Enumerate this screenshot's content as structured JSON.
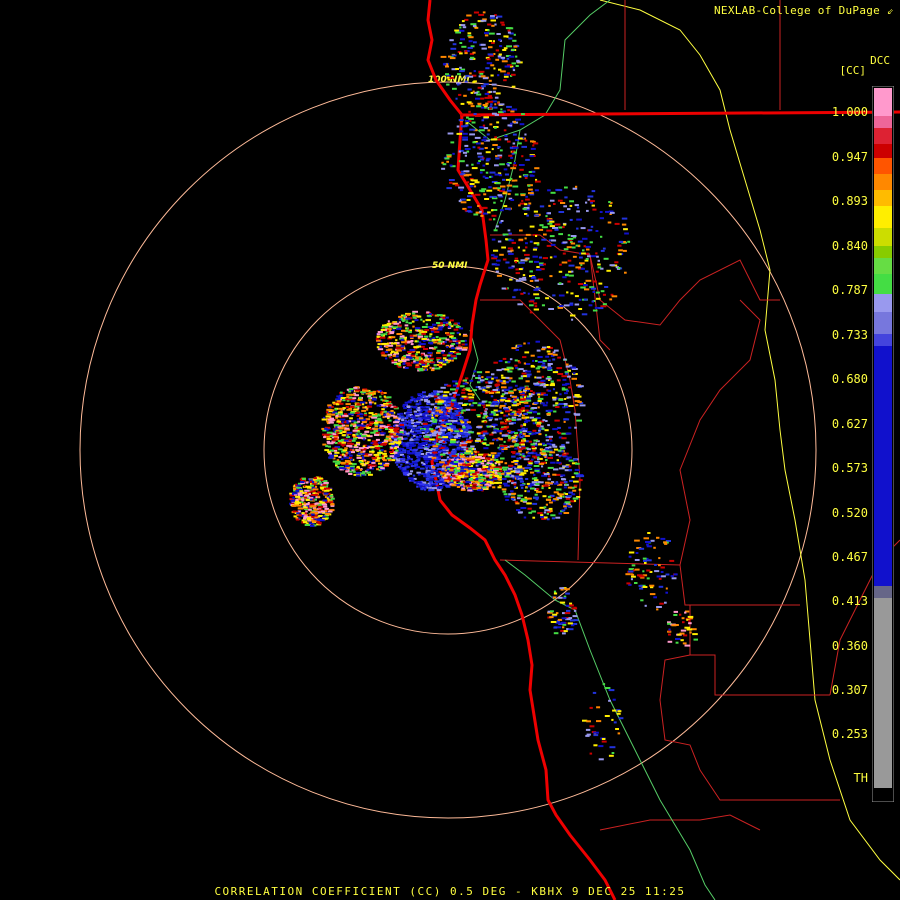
{
  "header": {
    "credit": "NEXLAB-College of DuPage",
    "credit_icon": "arrow-icon",
    "product_code": "DCC",
    "units": "[CC]"
  },
  "footer": {
    "caption": "CORRELATION COEFFICIENT (CC) 0.5 DEG - KBHX 9 DEC 25 11:25"
  },
  "range_rings": {
    "inner_label": "50 NMI",
    "outer_label": "100 NMI"
  },
  "color_scale": {
    "labels": [
      "1.000",
      "0.947",
      "0.893",
      "0.840",
      "0.787",
      "0.733",
      "0.680",
      "0.627",
      "0.573",
      "0.520",
      "0.467",
      "0.413",
      "0.360",
      "0.307",
      "0.253",
      "TH"
    ],
    "colors": {
      "pink": "#ff99cc",
      "red": "#cc0000",
      "orange": "#ff8800",
      "yellow": "#ffee00",
      "green": "#44dd44",
      "lavender": "#9999ee",
      "blue": "#1111cc",
      "gray": "#999999"
    }
  },
  "map_colors": {
    "coastline": "#ee0000",
    "state_border": "#ffff40",
    "county_border": "#cc2222",
    "river": "#55cc66",
    "range_ring": "#ffbb99"
  }
}
